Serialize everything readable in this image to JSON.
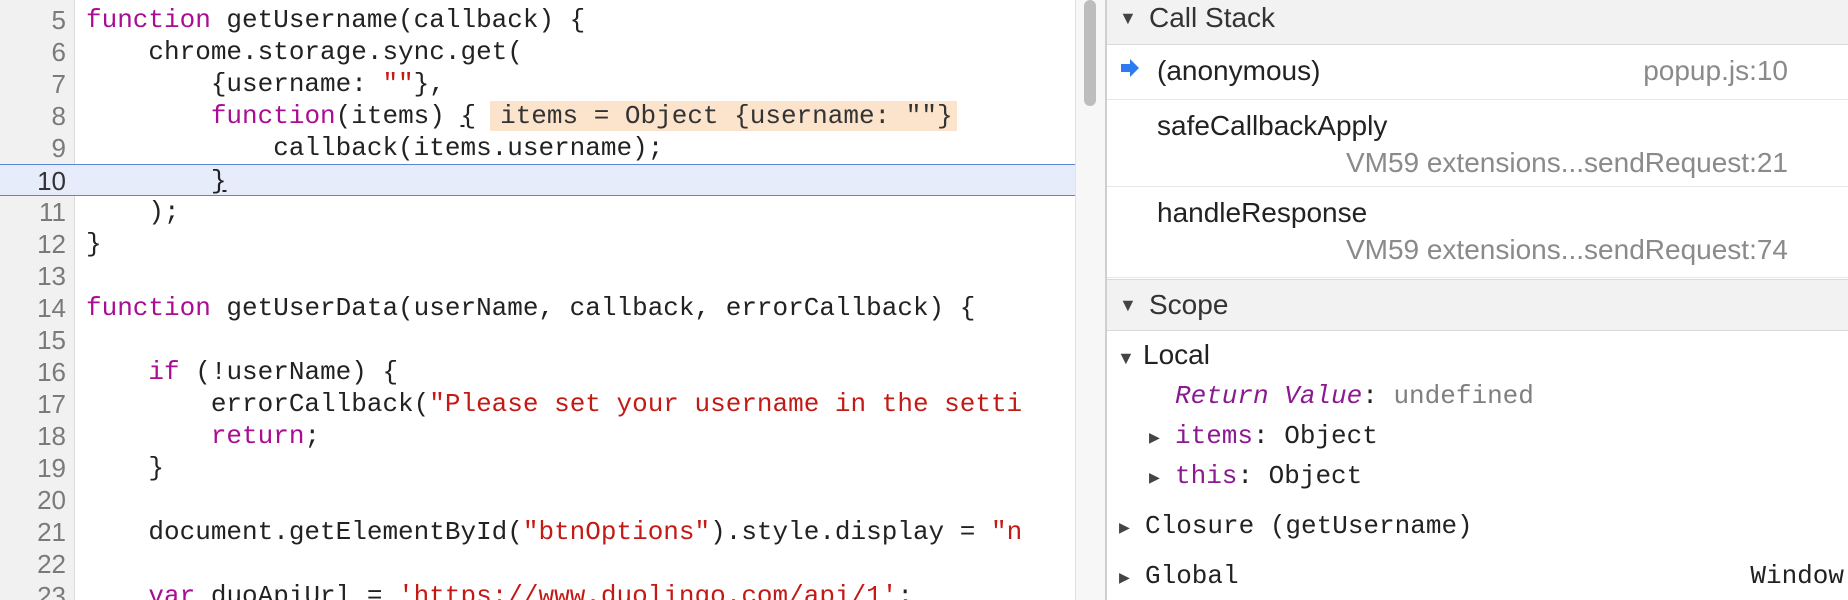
{
  "editor": {
    "lines": [
      {
        "n": "5",
        "tokens": [
          [
            "kw",
            "function"
          ],
          [
            "t",
            " getUsername(callback) {"
          ]
        ]
      },
      {
        "n": "6",
        "tokens": [
          [
            "t",
            "    chrome.storage.sync.get("
          ]
        ]
      },
      {
        "n": "7",
        "tokens": [
          [
            "t",
            "        {username: "
          ],
          [
            "str",
            "\"\""
          ],
          [
            "t",
            "},"
          ]
        ]
      },
      {
        "n": "8",
        "tokens": [
          [
            "t",
            "        "
          ],
          [
            "kw",
            "function"
          ],
          [
            "t",
            "(items) "
          ],
          [
            "cur",
            "{"
          ]
        ],
        "inline": "items = Object {username: \"\"}"
      },
      {
        "n": "9",
        "tokens": [
          [
            "t",
            "            callback(items.username);"
          ]
        ]
      },
      {
        "n": "10",
        "tokens": [
          [
            "t",
            "        "
          ],
          [
            "cur",
            "}"
          ]
        ],
        "current": true
      },
      {
        "n": "11",
        "tokens": [
          [
            "t",
            "    );"
          ]
        ]
      },
      {
        "n": "12",
        "tokens": [
          [
            "t",
            "}"
          ]
        ]
      },
      {
        "n": "13",
        "tokens": []
      },
      {
        "n": "14",
        "tokens": [
          [
            "kw",
            "function"
          ],
          [
            "t",
            " getUserData(userName, callback, errorCallback) {"
          ]
        ]
      },
      {
        "n": "15",
        "tokens": []
      },
      {
        "n": "16",
        "tokens": [
          [
            "t",
            "    "
          ],
          [
            "kw",
            "if"
          ],
          [
            "t",
            " (!userName) {"
          ]
        ]
      },
      {
        "n": "17",
        "tokens": [
          [
            "t",
            "        errorCallback("
          ],
          [
            "str",
            "\"Please set your username in the setti"
          ]
        ]
      },
      {
        "n": "18",
        "tokens": [
          [
            "t",
            "        "
          ],
          [
            "kw",
            "return"
          ],
          [
            "t",
            ";"
          ]
        ]
      },
      {
        "n": "19",
        "tokens": [
          [
            "t",
            "    }"
          ]
        ]
      },
      {
        "n": "20",
        "tokens": []
      },
      {
        "n": "21",
        "tokens": [
          [
            "t",
            "    document.getElementById("
          ],
          [
            "str",
            "\"btnOptions\""
          ],
          [
            "t",
            ").style.display = "
          ],
          [
            "str",
            "\"n"
          ]
        ]
      },
      {
        "n": "22",
        "tokens": []
      },
      {
        "n": "23",
        "tokens": [
          [
            "t",
            "    "
          ],
          [
            "kw",
            "var"
          ],
          [
            "t",
            " duoApiUrl = "
          ],
          [
            "str",
            "'https://www.duolingo.com/api/1'"
          ],
          [
            "t",
            ";"
          ]
        ]
      }
    ]
  },
  "call_stack": {
    "title": "Call Stack",
    "frames": [
      {
        "name": "(anonymous)",
        "location": "popup.js:10",
        "active": true
      },
      {
        "name": "safeCallbackApply",
        "location": "VM59 extensions...sendRequest:21"
      },
      {
        "name": "handleResponse",
        "location": "VM59 extensions...sendRequest:74"
      }
    ]
  },
  "scope": {
    "title": "Scope",
    "local": "Local",
    "return_key": "Return Value",
    "return_val": "undefined",
    "items_key": "items",
    "items_val": "Object",
    "this_key": "this",
    "this_val": "Object",
    "closure": "Closure (getUsername)",
    "global": "Global",
    "global_val": "Window"
  },
  "colors": {
    "keyword": "#aa0d91",
    "string": "#c41a16",
    "accent": "#2d7bf0"
  }
}
